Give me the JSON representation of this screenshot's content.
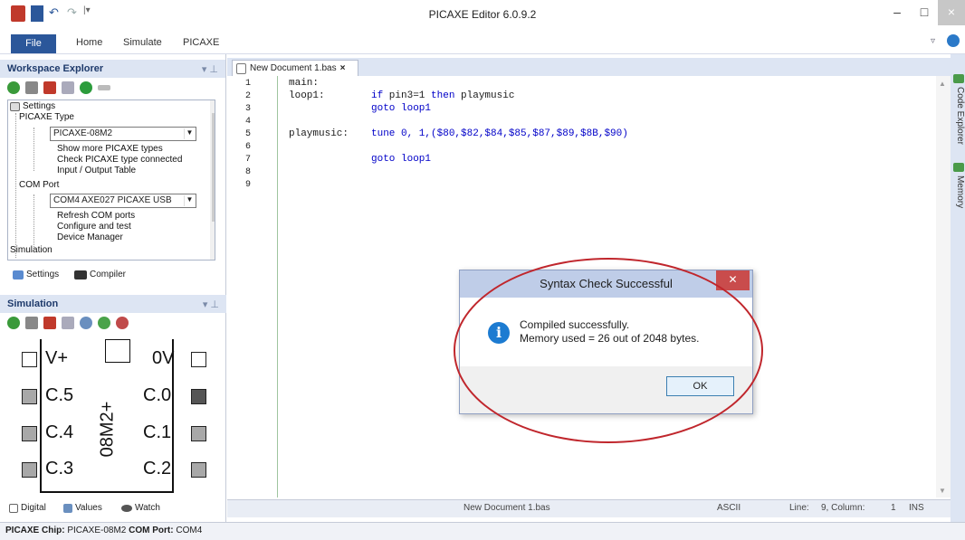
{
  "window": {
    "title": "PICAXE Editor 6.0.9.2",
    "close": "×",
    "min": "–",
    "max": "□"
  },
  "ribbon": {
    "file": "File",
    "tabs": [
      "Home",
      "Simulate",
      "PICAXE"
    ]
  },
  "workspace": {
    "title": "Workspace Explorer",
    "tree": {
      "settings": "Settings",
      "picaxe_type": "PICAXE Type",
      "chip_value": "PICAXE-08M2",
      "show_more": "Show more PICAXE types",
      "check_type": "Check PICAXE type connected",
      "io_table": "Input / Output Table",
      "com_port": "COM Port",
      "com_value": "COM4 AXE027 PICAXE USB",
      "refresh": "Refresh COM ports",
      "configure": "Configure and test",
      "device_mgr": "Device Manager",
      "simulation": "Simulation"
    },
    "tabs": {
      "settings": "Settings",
      "compiler": "Compiler"
    }
  },
  "simulation": {
    "title": "Simulation",
    "chip_name": "08M2+",
    "pins_left": [
      "V+",
      "C.5",
      "C.4",
      "C.3"
    ],
    "pins_right": [
      "0V",
      "C.0",
      "C.1",
      "C.2"
    ],
    "tabs": {
      "digital": "Digital",
      "values": "Values",
      "watch": "Watch"
    }
  },
  "editor": {
    "tab_label": "New Document 1.bas",
    "line_numbers": [
      "1",
      "2",
      "3",
      "4",
      "5",
      "6",
      "7",
      "8",
      "9"
    ],
    "code": {
      "l1_label": "main:",
      "l2_label": "loop1:",
      "l2_kw": "if",
      "l2_mid": " pin3=1 ",
      "l2_kw2": "then",
      "l2_rest": " playmusic",
      "l3": "goto loop1",
      "l5_label": "playmusic:",
      "l5_code": "tune 0, 1,($80,$82,$84,$85,$87,$89,$8B,$90)",
      "l7": "goto loop1"
    }
  },
  "right_bar": {
    "code_explorer": "Code Explorer",
    "memory": "Memory"
  },
  "status": {
    "doc": "New Document 1.bas",
    "encoding": "ASCII",
    "line_label": "Line:",
    "line_value": "9, Column:",
    "col_value": "1",
    "mode": "INS"
  },
  "bottom": {
    "chip_label": "PICAXE Chip:",
    "chip_value": "PICAXE-08M2",
    "port_label": "COM Port:",
    "port_value": "COM4"
  },
  "dialog": {
    "title": "Syntax Check Successful",
    "line1": "Compiled successfully.",
    "line2": "Memory used = 26 out of 2048 bytes.",
    "ok": "OK",
    "icon": "i"
  },
  "colors": {
    "accent": "#2b579a",
    "annotation": "#c0262c"
  }
}
